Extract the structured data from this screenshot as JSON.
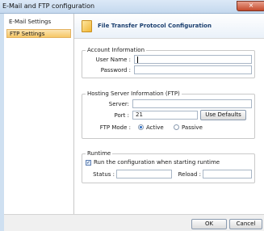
{
  "window": {
    "title": "E-Mail and FTP configuration",
    "close_glyph": "×"
  },
  "sidebar": {
    "items": [
      {
        "label": "E-Mail Settings"
      },
      {
        "label": "FTP Settings"
      }
    ]
  },
  "header": {
    "title": "File Transfer Protocol Configuration"
  },
  "account": {
    "group_label": "Account Information",
    "username_label": "User Name :",
    "username_value": "",
    "password_label": "Password :",
    "password_value": ""
  },
  "hosting": {
    "group_label": "Hosting Server Information (FTP)",
    "server_label": "Server:",
    "server_value": "",
    "port_label": "Port :",
    "port_value": "21",
    "use_defaults_label": "Use Defaults",
    "ftp_mode_label": "FTP Mode :",
    "active_label": "Active",
    "passive_label": "Passive"
  },
  "runtime": {
    "group_label": "Runtime",
    "run_checkbox_label": "Run the configuration when starting runtime",
    "run_checked": true,
    "status_label": "Status :",
    "status_value": "",
    "reload_label": "Reload :",
    "reload_value": ""
  },
  "footer": {
    "ok_label": "OK",
    "cancel_label": "Cancel"
  }
}
